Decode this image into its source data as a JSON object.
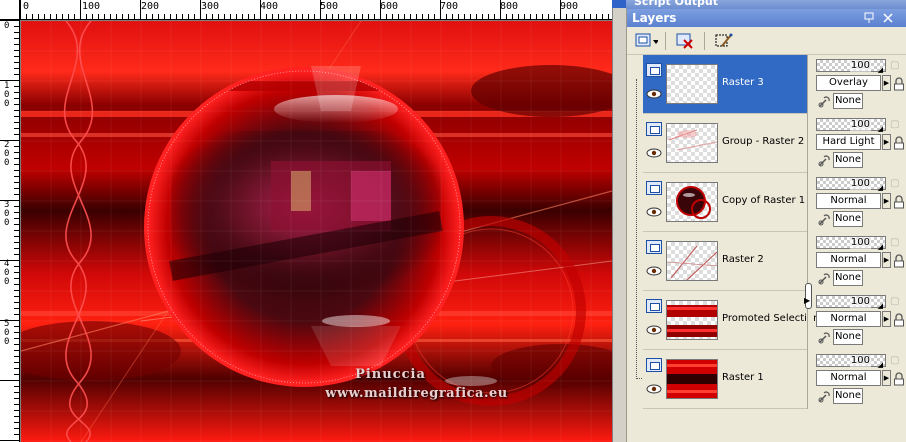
{
  "window": {
    "script_output_title": "Script Output",
    "layers_title": "Layers",
    "title_buttons": [
      "pin-icon",
      "close-icon"
    ]
  },
  "ruler": {
    "top_labels": [
      "0",
      "100",
      "200",
      "300",
      "400",
      "500",
      "600",
      "700",
      "800",
      "900"
    ],
    "left_labels": [
      "0",
      "100",
      "200",
      "300",
      "400",
      "500"
    ]
  },
  "watermark": {
    "line1": "Pinuccia",
    "line2": "www.maildiregrafica.eu"
  },
  "toolbar": {
    "icons": [
      "new-layer-icon",
      "delete-layer-icon",
      "layer-properties-icon"
    ]
  },
  "layers": [
    {
      "name": "Raster 3",
      "opacity": "100",
      "blend": "Overlay",
      "link": "None",
      "selected": true,
      "thumb": "transparent"
    },
    {
      "name": "Group - Raster 2",
      "opacity": "100",
      "blend": "Hard Light",
      "link": "None",
      "selected": false,
      "thumb": "faint"
    },
    {
      "name": "Copy of Raster 1",
      "opacity": "100",
      "blend": "Normal",
      "link": "None",
      "selected": false,
      "thumb": "sphere"
    },
    {
      "name": "Raster 2",
      "opacity": "100",
      "blend": "Normal",
      "link": "None",
      "selected": false,
      "thumb": "lines"
    },
    {
      "name": "Promoted Selection",
      "opacity": "100",
      "blend": "Normal",
      "link": "None",
      "selected": false,
      "thumb": "bands"
    },
    {
      "name": "Raster 1",
      "opacity": "100",
      "blend": "Normal",
      "link": "None",
      "selected": false,
      "thumb": "full"
    }
  ],
  "colors": {
    "selection": "#316ac5",
    "titlebar": "#5a82d0",
    "canvas_red": "#e00000",
    "canvas_dark": "#3a0000"
  }
}
